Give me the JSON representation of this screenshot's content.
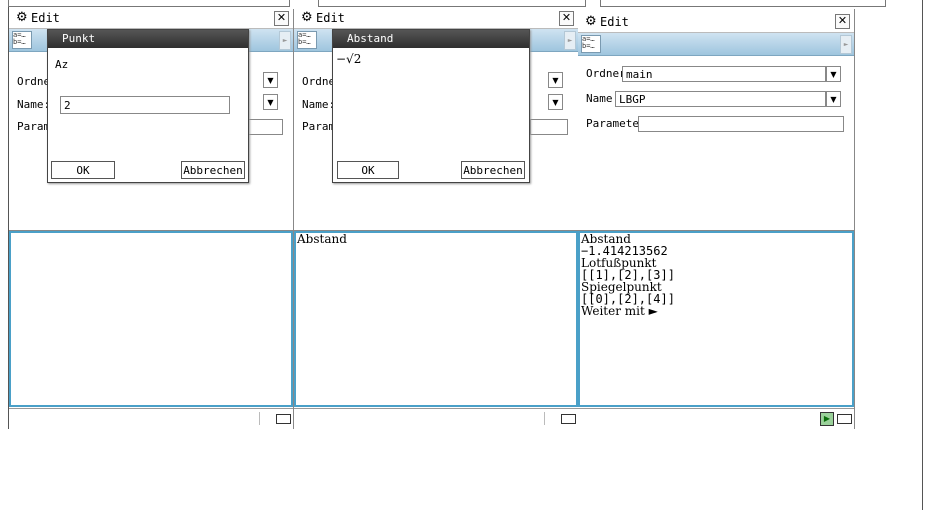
{
  "screens": [
    {
      "title": "Edit",
      "toolbar_icon": "a=… b=…",
      "form": {
        "folder_label": "Ordner",
        "name_label": "Name:",
        "param_label": "Param"
      },
      "dialog": {
        "title": "Punkt",
        "prompt": "Az",
        "input_value": "2",
        "ok": "OK",
        "cancel": "Abbrechen"
      },
      "output": []
    },
    {
      "title": "Edit",
      "toolbar_icon": "a=… b=…",
      "form": {
        "folder_label": "Ordner",
        "name_label": "Name:",
        "param_label": "Param"
      },
      "dialog": {
        "title": "Abstand",
        "value": "−√2",
        "ok": "OK",
        "cancel": "Abbrechen"
      },
      "output": [
        "Abstand"
      ]
    },
    {
      "title": "Edit",
      "toolbar_icon": "a=… b=…",
      "form": {
        "folder_label": "Ordner:",
        "folder_value": "main",
        "name_label": "Name:",
        "name_value": "LBGP",
        "param_label": "Parameter:"
      },
      "output": [
        "Abstand",
        "−1.414213562",
        "Lotfußpunkt",
        "[[1],[2],[3]]",
        "Spiegelpunkt",
        "[[0],[2],[4]]",
        "Weiter mit ►"
      ]
    }
  ],
  "icons": {
    "gear": "gear-icon",
    "close": "close-icon",
    "dropdown": "chevron-down-icon",
    "battery": "battery-icon",
    "play": "play-icon"
  },
  "colors": {
    "toolbar": "#9ec5de",
    "output_border": "#4aa0c8",
    "dialog_title": "#3a3a3a"
  }
}
